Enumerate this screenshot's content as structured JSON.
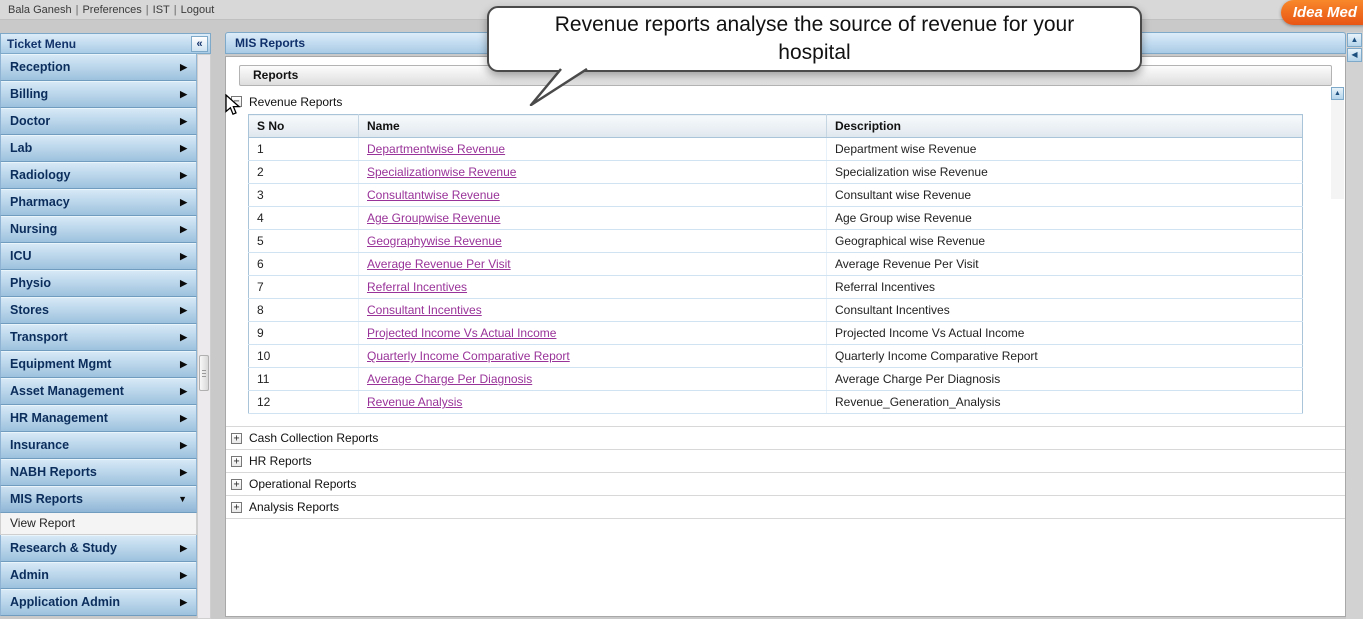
{
  "top_bar": {
    "user": "Bala Ganesh",
    "links": [
      "Preferences",
      "IST",
      "Logout"
    ],
    "separator": "|"
  },
  "logo": {
    "text": "Idea Med"
  },
  "sidebar": {
    "title": "Ticket Menu",
    "items": [
      {
        "label": "Reception",
        "arrow": "right"
      },
      {
        "label": "Billing",
        "arrow": "right"
      },
      {
        "label": "Doctor",
        "arrow": "right"
      },
      {
        "label": "Lab",
        "arrow": "right"
      },
      {
        "label": "Radiology",
        "arrow": "right"
      },
      {
        "label": "Pharmacy",
        "arrow": "right"
      },
      {
        "label": "Nursing",
        "arrow": "right"
      },
      {
        "label": "ICU",
        "arrow": "right"
      },
      {
        "label": "Physio",
        "arrow": "right"
      },
      {
        "label": "Stores",
        "arrow": "right"
      },
      {
        "label": "Transport",
        "arrow": "right"
      },
      {
        "label": "Equipment Mgmt",
        "arrow": "right"
      },
      {
        "label": "Asset Management",
        "arrow": "right"
      },
      {
        "label": "HR Management",
        "arrow": "right"
      },
      {
        "label": "Insurance",
        "arrow": "right"
      },
      {
        "label": "NABH Reports",
        "arrow": "right"
      },
      {
        "label": "MIS Reports",
        "arrow": "down",
        "selected": true
      },
      {
        "label": "View Report",
        "type": "sub"
      },
      {
        "label": "Research & Study",
        "arrow": "right"
      },
      {
        "label": "Admin",
        "arrow": "right"
      },
      {
        "label": "Application Admin",
        "arrow": "right"
      }
    ]
  },
  "main": {
    "title": "MIS Reports",
    "panel_title": "Reports",
    "expanded_section": {
      "label": "Revenue Reports"
    },
    "collapsed_sections": [
      "Cash Collection Reports",
      "HR Reports",
      "Operational Reports",
      "Analysis Reports"
    ],
    "table": {
      "columns": [
        "S No",
        "Name",
        "Description"
      ],
      "rows": [
        [
          "1",
          "Departmentwise Revenue",
          "Department wise Revenue"
        ],
        [
          "2",
          "Specializationwise Revenue",
          "Specialization wise Revenue"
        ],
        [
          "3",
          "Consultantwise Revenue",
          "Consultant wise Revenue"
        ],
        [
          "4",
          "Age Groupwise Revenue",
          "Age Group wise Revenue"
        ],
        [
          "5",
          "Geographywise Revenue",
          "Geographical wise Revenue"
        ],
        [
          "6",
          "Average Revenue Per Visit",
          "Average Revenue Per Visit"
        ],
        [
          "7",
          "Referral Incentives",
          "Referral Incentives"
        ],
        [
          "8",
          "Consultant Incentives",
          "Consultant Incentives"
        ],
        [
          "9",
          "Projected Income Vs Actual Income",
          "Projected Income Vs Actual Income"
        ],
        [
          "10",
          "Quarterly Income Comparative Report",
          "Quarterly Income Comparative Report"
        ],
        [
          "11",
          "Average Charge Per Diagnosis",
          "Average Charge Per Diagnosis"
        ],
        [
          "12",
          "Revenue Analysis",
          "Revenue_Generation_Analysis"
        ]
      ]
    }
  },
  "callout": {
    "text": "Revenue reports analyse the source of revenue for your hospital"
  },
  "icons": {
    "sidebar_collapse": "«",
    "expand_box": "+",
    "collapse_box": "−",
    "scroll_up": "▲",
    "panel_collapse": "◀",
    "item_arrow_right": "▶",
    "item_arrow_down": "▼"
  },
  "colors": {
    "link_purple": "#993399",
    "sidebar_blue": "#9dc2de",
    "header_blue": "#a9cbe6",
    "logo_orange": "#f8882a"
  }
}
